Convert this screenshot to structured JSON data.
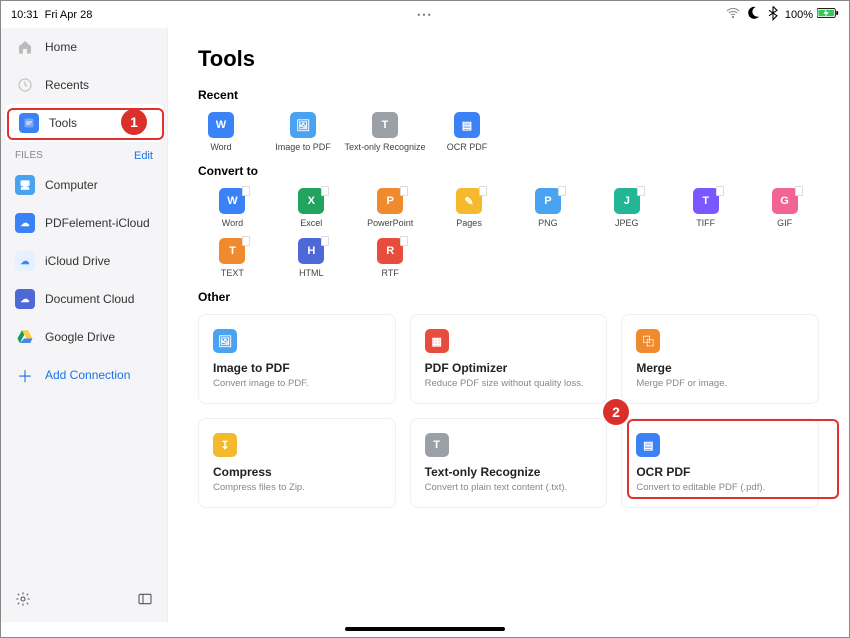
{
  "status": {
    "time": "10:31",
    "date": "Fri Apr 28",
    "battery": "100%"
  },
  "sidebar": {
    "top": [
      {
        "label": "Home"
      },
      {
        "label": "Recents"
      },
      {
        "label": "Tools"
      }
    ],
    "section": {
      "title": "FILES",
      "edit": "Edit"
    },
    "files": [
      {
        "label": "Computer"
      },
      {
        "label": "PDFelement-iCloud"
      },
      {
        "label": "iCloud Drive"
      },
      {
        "label": "Document Cloud"
      },
      {
        "label": "Google Drive"
      },
      {
        "label": "Add Connection"
      }
    ]
  },
  "main": {
    "title": "Tools",
    "recent_label": "Recent",
    "recent": [
      {
        "label": "Word"
      },
      {
        "label": "Image to PDF"
      },
      {
        "label": "Text-only Recognize"
      },
      {
        "label": "OCR PDF"
      }
    ],
    "convert_label": "Convert to",
    "convert": [
      {
        "label": "Word",
        "g": "W",
        "c": "c-blue"
      },
      {
        "label": "Excel",
        "g": "X",
        "c": "c-green"
      },
      {
        "label": "PowerPoint",
        "g": "P",
        "c": "c-orange"
      },
      {
        "label": "Pages",
        "g": "✎",
        "c": "c-yellow"
      },
      {
        "label": "PNG",
        "g": "P",
        "c": "c-lblue"
      },
      {
        "label": "JPEG",
        "g": "J",
        "c": "c-teal"
      },
      {
        "label": "TIFF",
        "g": "T",
        "c": "c-purple"
      },
      {
        "label": "GIF",
        "g": "G",
        "c": "c-pink"
      },
      {
        "label": "TEXT",
        "g": "T",
        "c": "c-orange"
      },
      {
        "label": "HTML",
        "g": "H",
        "c": "c-navy"
      },
      {
        "label": "RTF",
        "g": "R",
        "c": "c-red"
      }
    ],
    "other_label": "Other",
    "other": [
      {
        "title": "Image to PDF",
        "desc": "Convert image to PDF.",
        "c": "c-lblue",
        "g": "🖼"
      },
      {
        "title": "PDF Optimizer",
        "desc": "Reduce PDF size without quality loss.",
        "c": "c-red",
        "g": "▦"
      },
      {
        "title": "Merge",
        "desc": "Merge PDF or image.",
        "c": "c-orange",
        "g": "⿻"
      },
      {
        "title": "Compress",
        "desc": "Compress files to Zip.",
        "c": "c-yellow",
        "g": "↧"
      },
      {
        "title": "Text-only Recognize",
        "desc": "Convert to plain text content (.txt).",
        "c": "c-gray",
        "g": "T"
      },
      {
        "title": "OCR PDF",
        "desc": "Convert to editable PDF (.pdf).",
        "c": "c-blue",
        "g": "▤"
      }
    ]
  },
  "annotations": {
    "n1": "1",
    "n2": "2"
  }
}
